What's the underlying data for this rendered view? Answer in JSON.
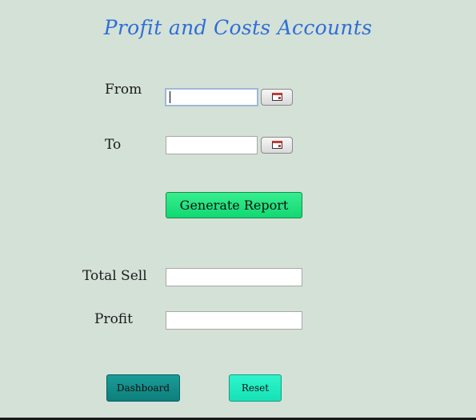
{
  "title": "Profit and Costs Accounts",
  "form": {
    "from_label": "From",
    "from_value": "",
    "to_label": "To",
    "to_value": "",
    "generate_label": "Generate Report",
    "total_sell_label": "Total Sell",
    "total_sell_value": "",
    "profit_label": "Profit",
    "profit_value": ""
  },
  "actions": {
    "dashboard_label": "Dashboard",
    "reset_label": "Reset"
  },
  "icons": {
    "from_picker": "calendar-icon",
    "to_picker": "calendar-icon"
  },
  "colors": {
    "background": "#d4e1d7",
    "title": "#2f6fd6",
    "generate_button": "#12d872",
    "dashboard_button": "#0d7f7c",
    "reset_button": "#16e2b6"
  }
}
